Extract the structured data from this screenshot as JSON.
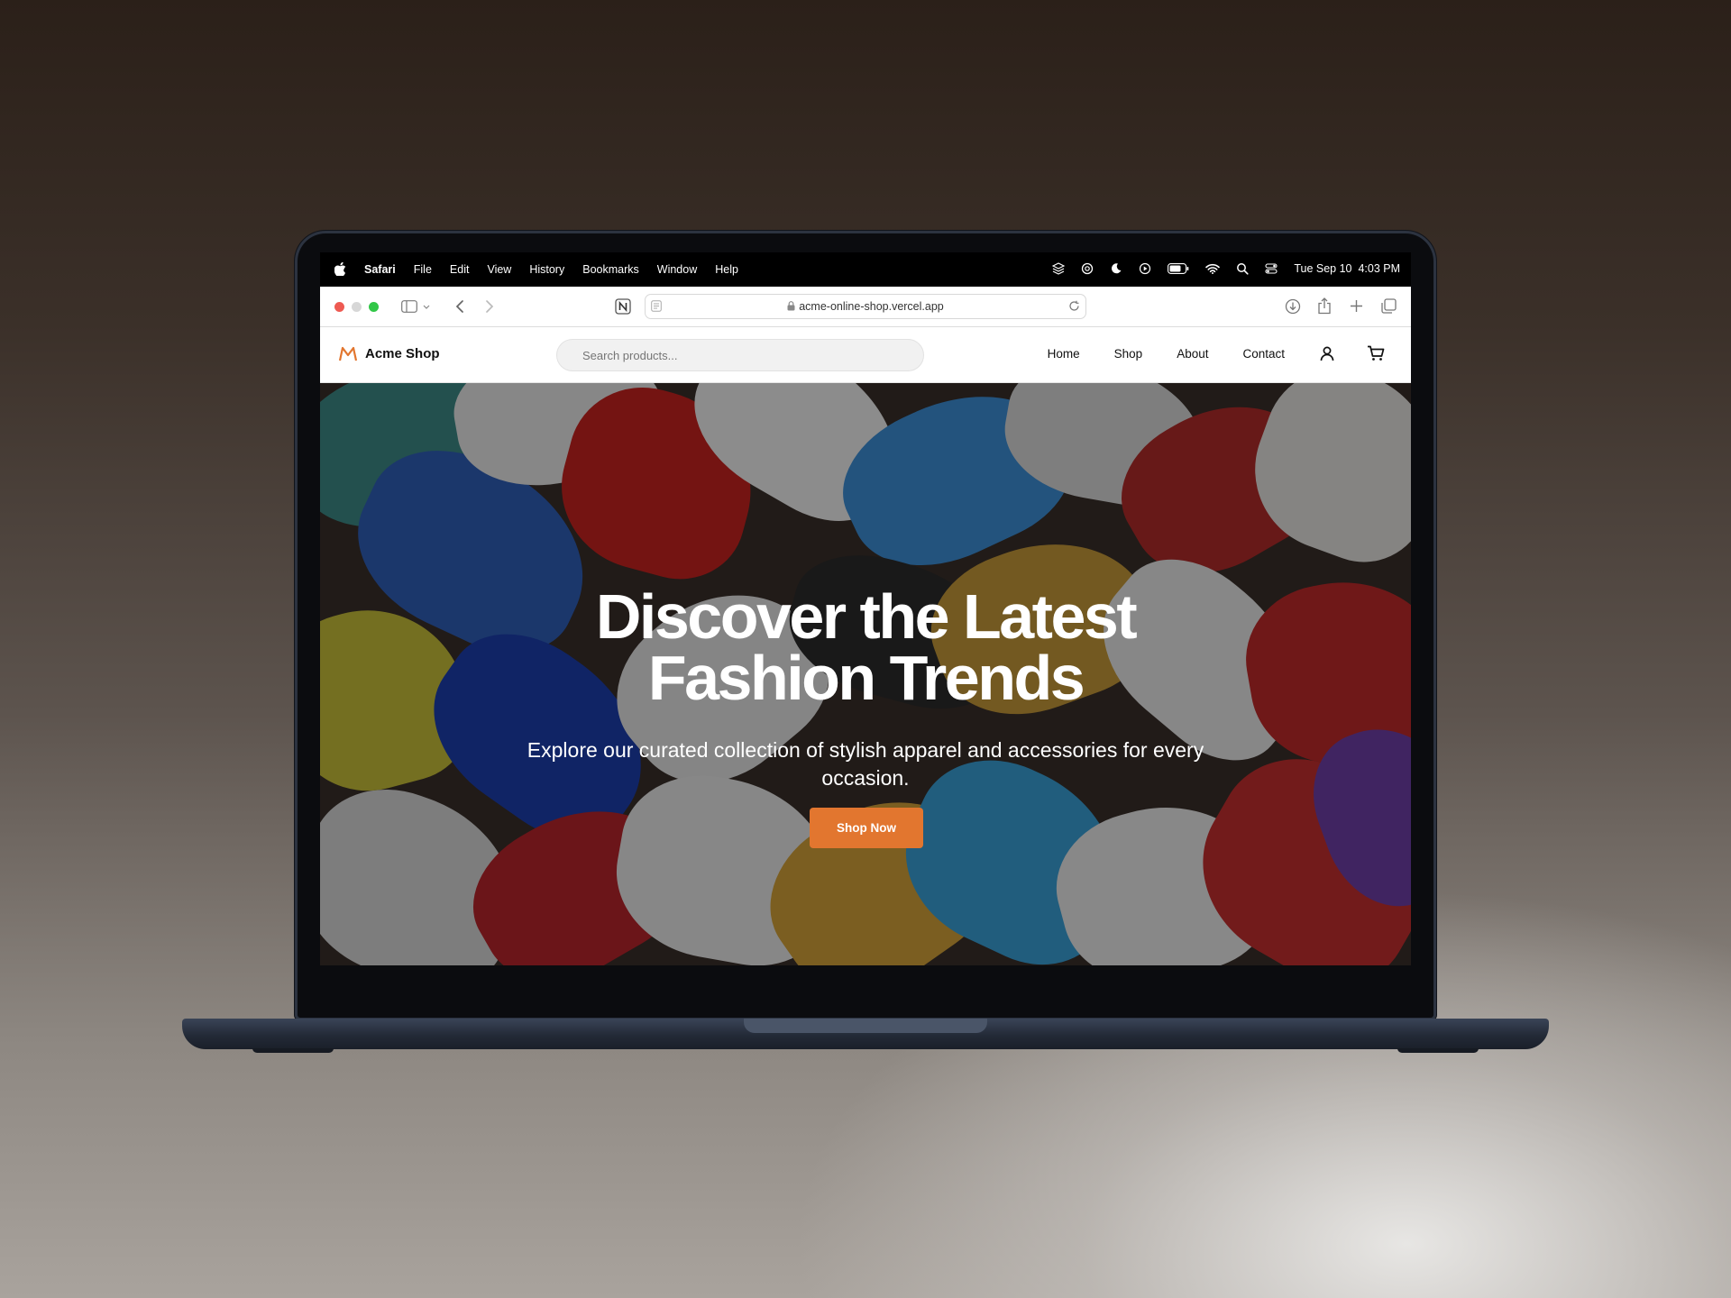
{
  "menubar": {
    "app_name": "Safari",
    "items": [
      "File",
      "Edit",
      "View",
      "History",
      "Bookmarks",
      "Window",
      "Help"
    ],
    "datetime": "Tue Sep 10  4:03 PM"
  },
  "browser": {
    "url": "acme-online-shop.vercel.app"
  },
  "site": {
    "brand": "Acme Shop",
    "search_placeholder": "Search products...",
    "nav": [
      "Home",
      "Shop",
      "About",
      "Contact"
    ],
    "accent_color": "#e2762f"
  },
  "hero": {
    "title_line1": "Discover the Latest",
    "title_line2": "Fashion Trends",
    "subtitle": "Explore our curated collection of stylish apparel and accessories for every occasion.",
    "cta_label": "Shop Now"
  }
}
